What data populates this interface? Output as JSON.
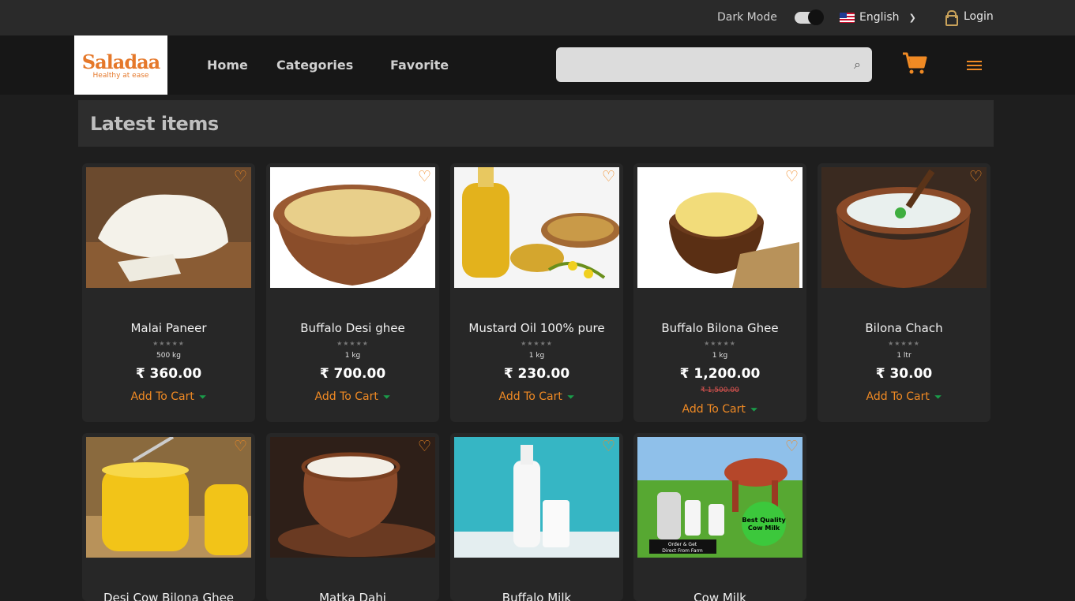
{
  "topbar": {
    "dark_mode_label": "Dark Mode",
    "language": "English",
    "login": "Login"
  },
  "brand": {
    "logo_text": "Saladaa",
    "tagline": "Healthy at ease"
  },
  "nav": {
    "home": "Home",
    "categories": "Categories",
    "favorite": "Favorite"
  },
  "search": {
    "value": ""
  },
  "section": {
    "title": "Latest items"
  },
  "products": [
    {
      "name": "Malai Paneer",
      "stars": "★★★★★",
      "unit": "500 kg",
      "price": "₹ 360.00",
      "old_price": "",
      "add_to_cart": "Add To Cart"
    },
    {
      "name": "Buffalo Desi ghee",
      "stars": "★★★★★",
      "unit": "1 kg",
      "price": "₹ 700.00",
      "old_price": "",
      "add_to_cart": "Add To Cart"
    },
    {
      "name": "Mustard Oil 100% pure",
      "stars": "★★★★★",
      "unit": "1 kg",
      "price": "₹ 230.00",
      "old_price": "",
      "add_to_cart": "Add To Cart"
    },
    {
      "name": "Buffalo Bilona Ghee",
      "stars": "★★★★★",
      "unit": "1 kg",
      "price": "₹ 1,200.00",
      "old_price": "₹ 1,500.00",
      "add_to_cart": "Add To Cart"
    },
    {
      "name": "Bilona Chach",
      "stars": "★★★★★",
      "unit": "1 ltr",
      "price": "₹ 30.00",
      "old_price": "",
      "add_to_cart": "Add To Cart"
    },
    {
      "name": "Desi Cow Bilona Ghee"
    },
    {
      "name": "Matka Dahi"
    },
    {
      "name": "Buffalo Milk"
    },
    {
      "name": "Cow Milk",
      "badge": "Best Quality Cow Milk",
      "banner": "Order & Get Direct From Farm"
    }
  ],
  "colors": {
    "accent": "#f08a24",
    "cart_green": "#1a9d4a",
    "background": "#1e1e1e"
  }
}
